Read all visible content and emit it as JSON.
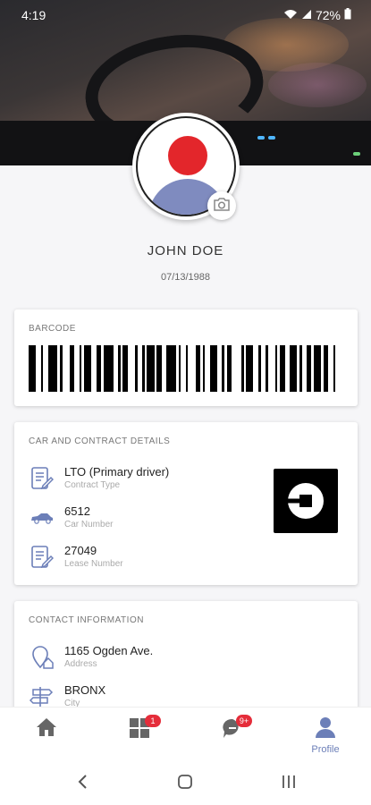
{
  "status_bar": {
    "time": "4:19",
    "battery": "72%"
  },
  "profile": {
    "name": "JOHN DOE",
    "dob": "07/13/1988"
  },
  "barcode_card": {
    "title": "BARCODE"
  },
  "car_card": {
    "title": "CAR AND CONTRACT DETAILS",
    "rows": [
      {
        "value": "LTO (Primary driver)",
        "label": "Contract Type",
        "icon": "contract-icon"
      },
      {
        "value": "6512",
        "label": "Car Number",
        "icon": "car-icon"
      },
      {
        "value": "27049",
        "label": "Lease Number",
        "icon": "lease-icon"
      }
    ],
    "logo": "uber-logo"
  },
  "contact_card": {
    "title": "CONTACT INFORMATION",
    "rows": [
      {
        "value": "1165 Ogden Ave.",
        "label": "Address",
        "icon": "address-icon"
      },
      {
        "value": "BRONX",
        "label": "City",
        "icon": "city-icon"
      }
    ]
  },
  "bottom_nav": {
    "items": [
      {
        "name": "home",
        "icon": "home-icon",
        "label": ""
      },
      {
        "name": "dashboard",
        "icon": "grid-icon",
        "label": "",
        "badge": "1"
      },
      {
        "name": "messages",
        "icon": "chat-icon",
        "label": "",
        "badge": "9+"
      },
      {
        "name": "profile",
        "icon": "profile-icon",
        "label": "Profile"
      }
    ]
  },
  "colors": {
    "accent": "#6c7fb8",
    "badge": "#e52d3a"
  }
}
